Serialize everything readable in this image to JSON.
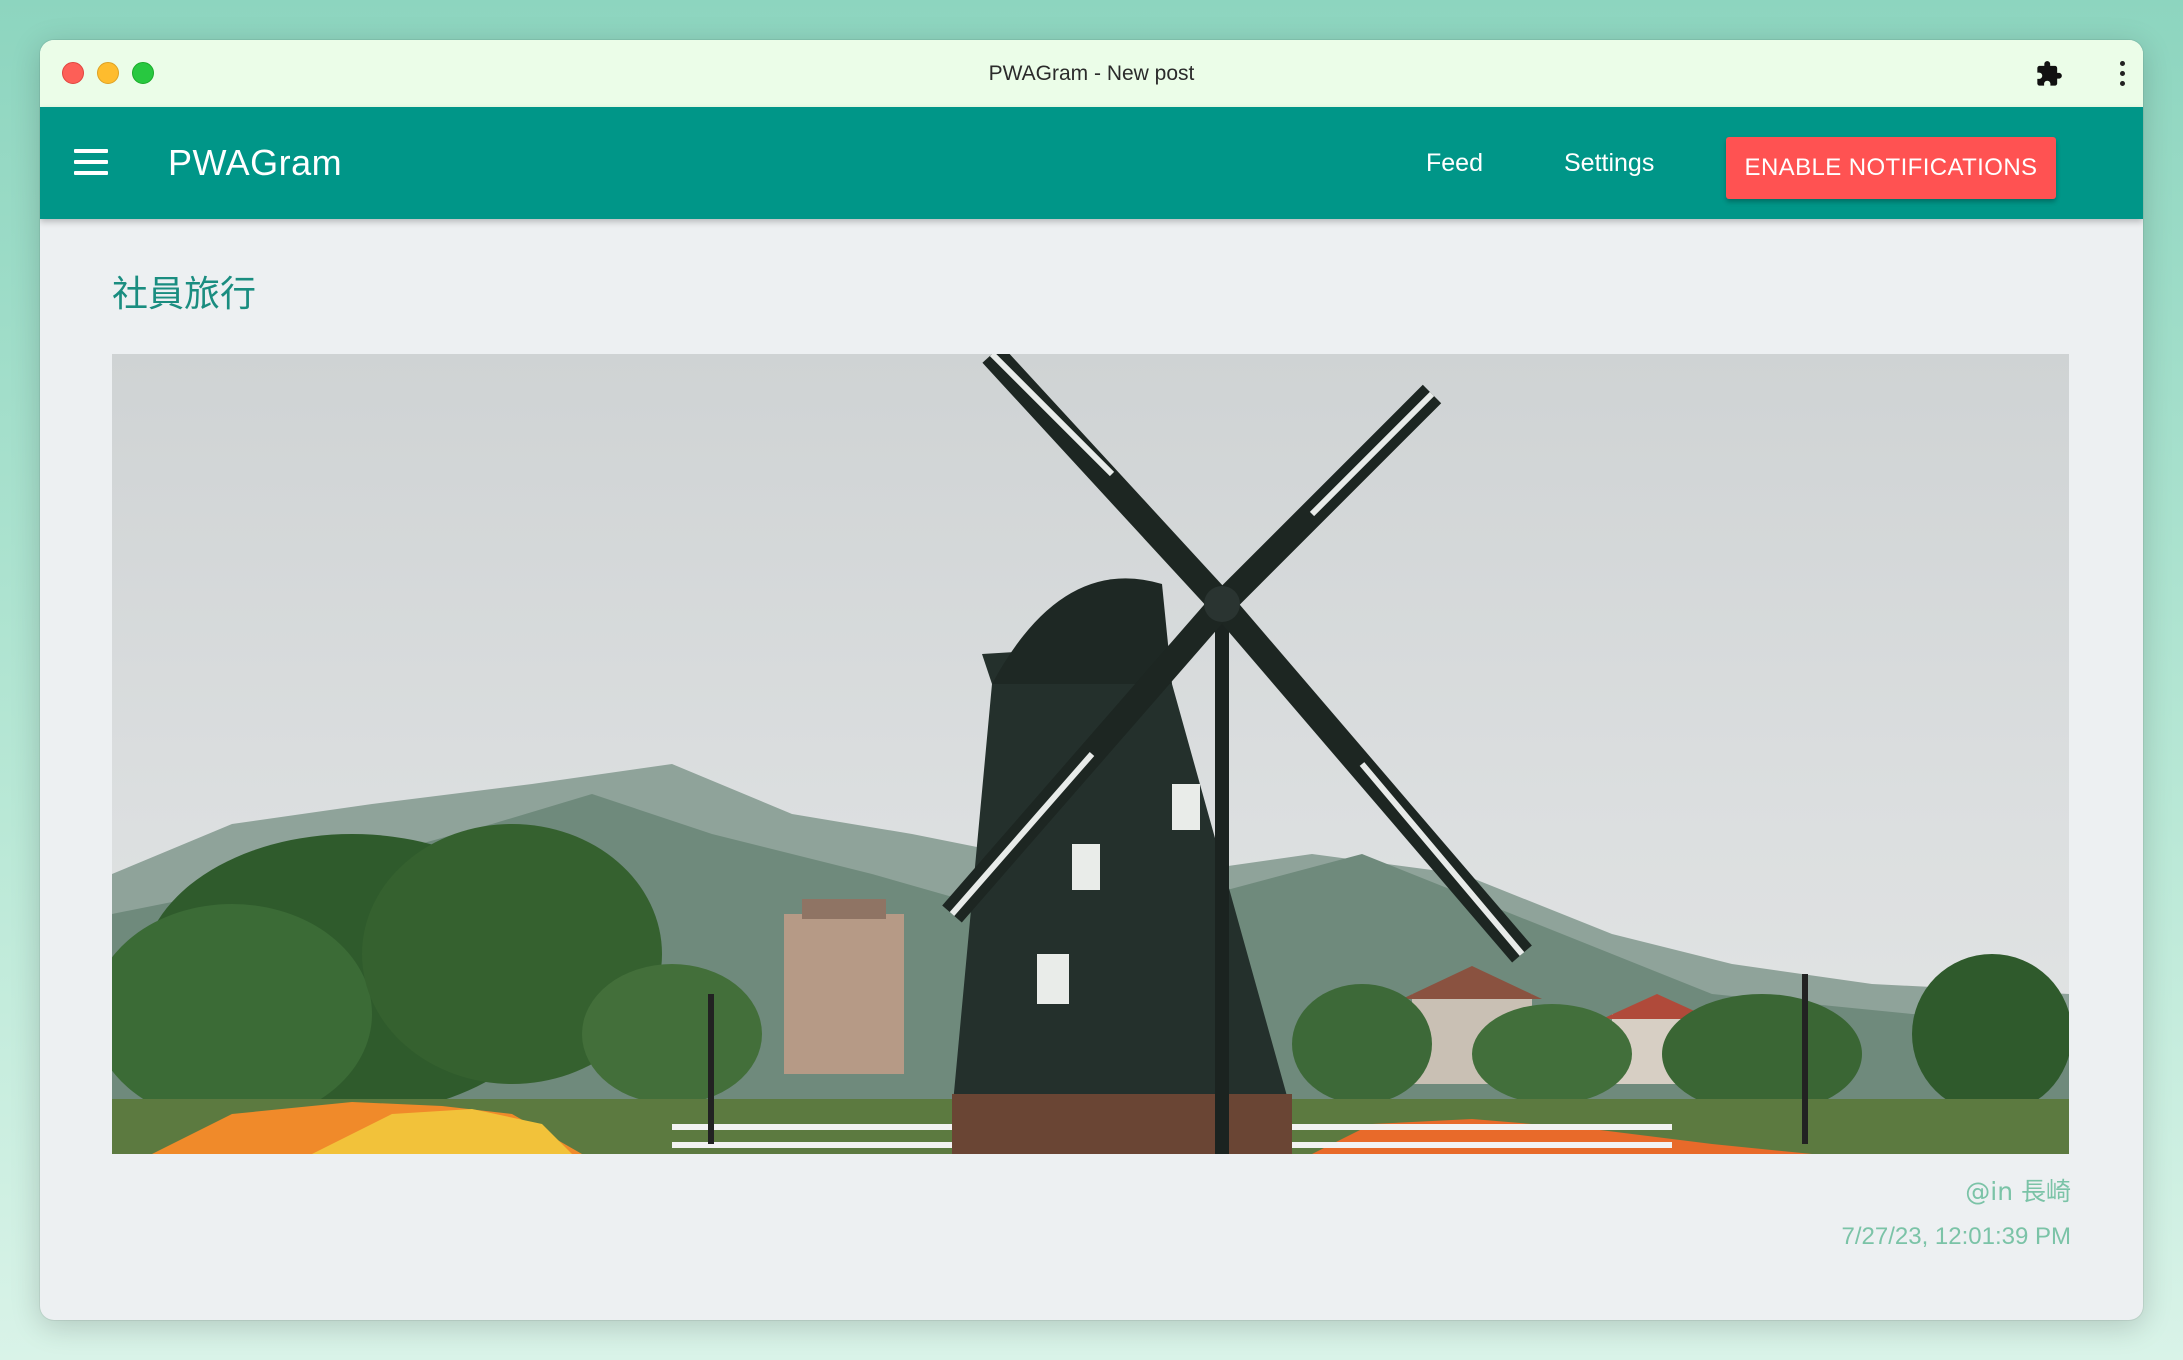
{
  "window": {
    "title": "PWAGram - New post",
    "icons": [
      "close-traffic-light",
      "minimize-traffic-light",
      "zoom-traffic-light",
      "puzzle-icon",
      "more-vert-icon"
    ]
  },
  "appbar": {
    "brand": "PWAGram",
    "menu_icon": "hamburger-menu-icon",
    "nav": {
      "feed": "Feed",
      "settings": "Settings"
    },
    "notify_button": "ENABLE NOTIFICATIONS"
  },
  "post": {
    "title": "社員旅行",
    "location": "@in 長崎",
    "timestamp": "7/27/23, 12:01:39 PM"
  },
  "colors": {
    "primary": "#009688",
    "accent": "#ff5252",
    "title_text": "#1a8d80",
    "meta_text": "#7bc3a7",
    "page_bg": "#edf0f2"
  }
}
